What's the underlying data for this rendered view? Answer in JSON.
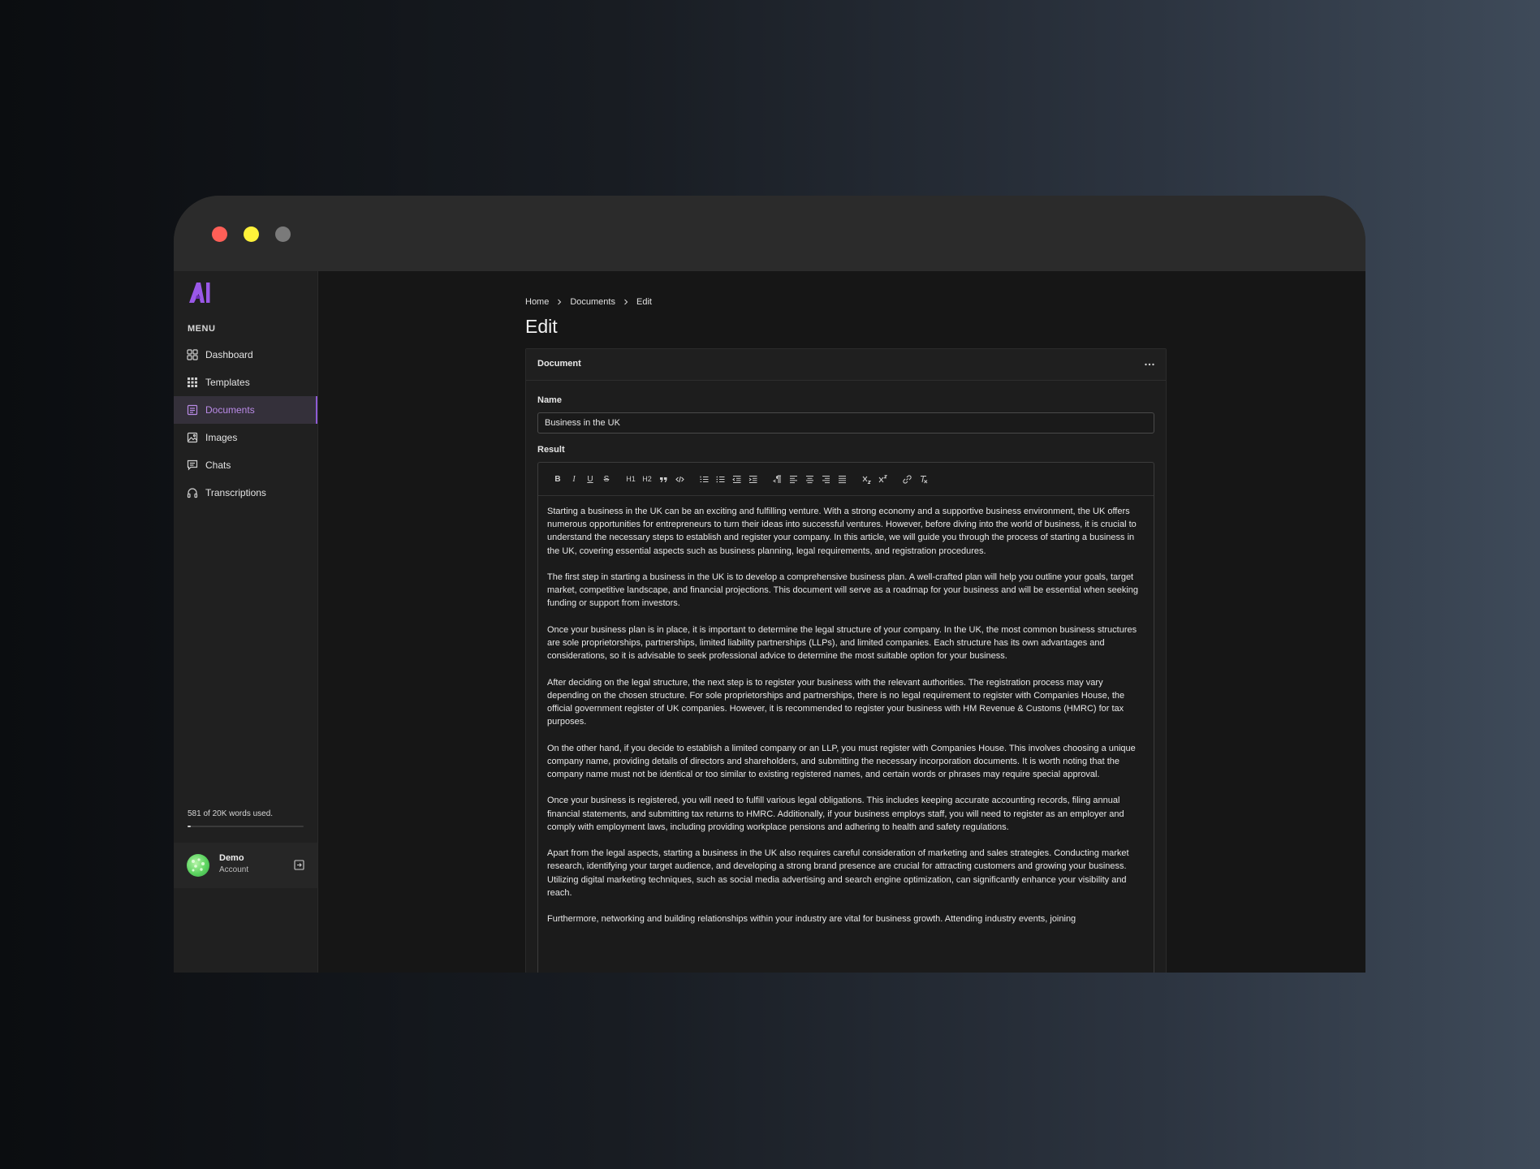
{
  "window": {
    "controls": {
      "close_color": "#ff5f57",
      "minimize_color": "#fff23a",
      "zoom_color": "#7a7a7a"
    }
  },
  "sidebar": {
    "logo_icon": "ai-logo-icon",
    "menu_heading": "MENU",
    "items": [
      {
        "label": "Dashboard",
        "icon": "grid-icon",
        "active": false
      },
      {
        "label": "Templates",
        "icon": "apps-icon",
        "active": false
      },
      {
        "label": "Documents",
        "icon": "document-icon",
        "active": true
      },
      {
        "label": "Images",
        "icon": "image-icon",
        "active": false
      },
      {
        "label": "Chats",
        "icon": "chat-icon",
        "active": false
      },
      {
        "label": "Transcriptions",
        "icon": "headphones-icon",
        "active": false
      }
    ],
    "usage": {
      "text": "581 of 20K words used.",
      "used": 581,
      "total": 20000
    },
    "account": {
      "name": "Demo",
      "subtitle": "Account",
      "logout_icon": "logout-icon"
    }
  },
  "breadcrumb": [
    "Home",
    "Documents",
    "Edit"
  ],
  "page_title": "Edit",
  "card": {
    "title": "Document",
    "name_label": "Name",
    "name_value": "Business in the UK",
    "result_label": "Result",
    "toolbar": [
      [
        "B",
        "I",
        "U",
        "S"
      ],
      [
        "H1",
        "H2",
        "quote",
        "code"
      ],
      [
        "ordered-list",
        "bullet-list",
        "outdent",
        "indent"
      ],
      [
        "rtl",
        "align-left",
        "align-center",
        "align-right",
        "align-justify"
      ],
      [
        "subscript",
        "superscript"
      ],
      [
        "link",
        "clear-format"
      ]
    ],
    "paragraphs": [
      "Starting a business in the UK can be an exciting and fulfilling venture. With a strong economy and a supportive business environment, the UK offers numerous opportunities for entrepreneurs to turn their ideas into successful ventures. However, before diving into the world of business, it is crucial to understand the necessary steps to establish and register your company. In this article, we will guide you through the process of starting a business in the UK, covering essential aspects such as business planning, legal requirements, and registration procedures.",
      "The first step in starting a business in the UK is to develop a comprehensive business plan. A well-crafted plan will help you outline your goals, target market, competitive landscape, and financial projections. This document will serve as a roadmap for your business and will be essential when seeking funding or support from investors.",
      "Once your business plan is in place, it is important to determine the legal structure of your company. In the UK, the most common business structures are sole proprietorships, partnerships, limited liability partnerships (LLPs), and limited companies. Each structure has its own advantages and considerations, so it is advisable to seek professional advice to determine the most suitable option for your business.",
      "After deciding on the legal structure, the next step is to register your business with the relevant authorities. The registration process may vary depending on the chosen structure. For sole proprietorships and partnerships, there is no legal requirement to register with Companies House, the official government register of UK companies. However, it is recommended to register your business with HM Revenue & Customs (HMRC) for tax purposes.",
      "On the other hand, if you decide to establish a limited company or an LLP, you must register with Companies House. This involves choosing a unique company name, providing details of directors and shareholders, and submitting the necessary incorporation documents. It is worth noting that the company name must not be identical or too similar to existing registered names, and certain words or phrases may require special approval.",
      "Once your business is registered, you will need to fulfill various legal obligations. This includes keeping accurate accounting records, filing annual financial statements, and submitting tax returns to HMRC. Additionally, if your business employs staff, you will need to register as an employer and comply with employment laws, including providing workplace pensions and adhering to health and safety regulations.",
      "Apart from the legal aspects, starting a business in the UK also requires careful consideration of marketing and sales strategies. Conducting market research, identifying your target audience, and developing a strong brand presence are crucial for attracting customers and growing your business. Utilizing digital marketing techniques, such as social media advertising and search engine optimization, can significantly enhance your visibility and reach.",
      "Furthermore, networking and building relationships within your industry are vital for business growth. Attending industry events, joining"
    ]
  }
}
